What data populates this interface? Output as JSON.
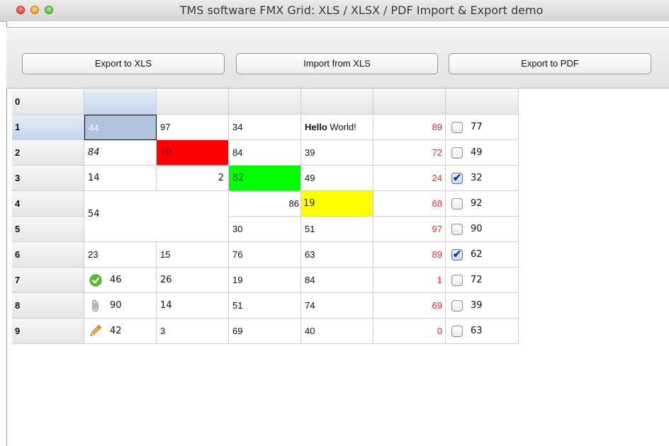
{
  "window": {
    "title": "TMS software FMX Grid: XLS / XLSX / PDF Import & Export demo"
  },
  "toolbar": {
    "export_xls_label": "Export to XLS",
    "import_xls_label": "Import from XLS",
    "export_pdf_label": "Export to PDF"
  },
  "grid": {
    "row_headers": [
      "0",
      "1",
      "2",
      "3",
      "4",
      "5",
      "6",
      "7",
      "8",
      "9"
    ],
    "colors": {
      "selected": "#b0c4de",
      "red": "#ff0000",
      "green": "#00ff00",
      "yellow": "#ffff00"
    },
    "r1": {
      "c1": "44",
      "c2": "97",
      "c3": "34",
      "c4_bold": "Hello",
      "c4_rest": " World!",
      "c5": "89",
      "c6": "77",
      "c6_checked": false
    },
    "r2": {
      "c1": "84",
      "c2": "70",
      "c3": "84",
      "c4": "39",
      "c5": "72",
      "c6": "49",
      "c6_checked": false
    },
    "r3": {
      "c1": "14",
      "c2": "2",
      "c3": "82",
      "c4": "49",
      "c5": "24",
      "c6": "32",
      "c6_checked": true
    },
    "r4": {
      "c1_merged": "54",
      "c3": "86",
      "c4": "19",
      "c5": "68",
      "c6": "92",
      "c6_checked": false
    },
    "r5": {
      "c3": "30",
      "c4": "51",
      "c5": "97",
      "c6": "90",
      "c6_checked": false
    },
    "r6": {
      "c1": "23",
      "c2": "15",
      "c3": "76",
      "c4": "63",
      "c5": "89",
      "c6": "62",
      "c6_checked": true
    },
    "r7": {
      "c1_icon": "checkmark-circle-icon",
      "c1": "46",
      "c2": "26",
      "c3": "19",
      "c4": "84",
      "c5": "1",
      "c6": "72",
      "c6_checked": false
    },
    "r8": {
      "c1_icon": "paperclip-icon",
      "c1": "90",
      "c2": "14",
      "c3": "51",
      "c4": "74",
      "c5": "69",
      "c6": "39",
      "c6_checked": false
    },
    "r9": {
      "c1_icon": "pencil-icon",
      "c1": "42",
      "c2": "3",
      "c3": "69",
      "c4": "40",
      "c5": "0",
      "c6": "63",
      "c6_checked": false
    }
  }
}
